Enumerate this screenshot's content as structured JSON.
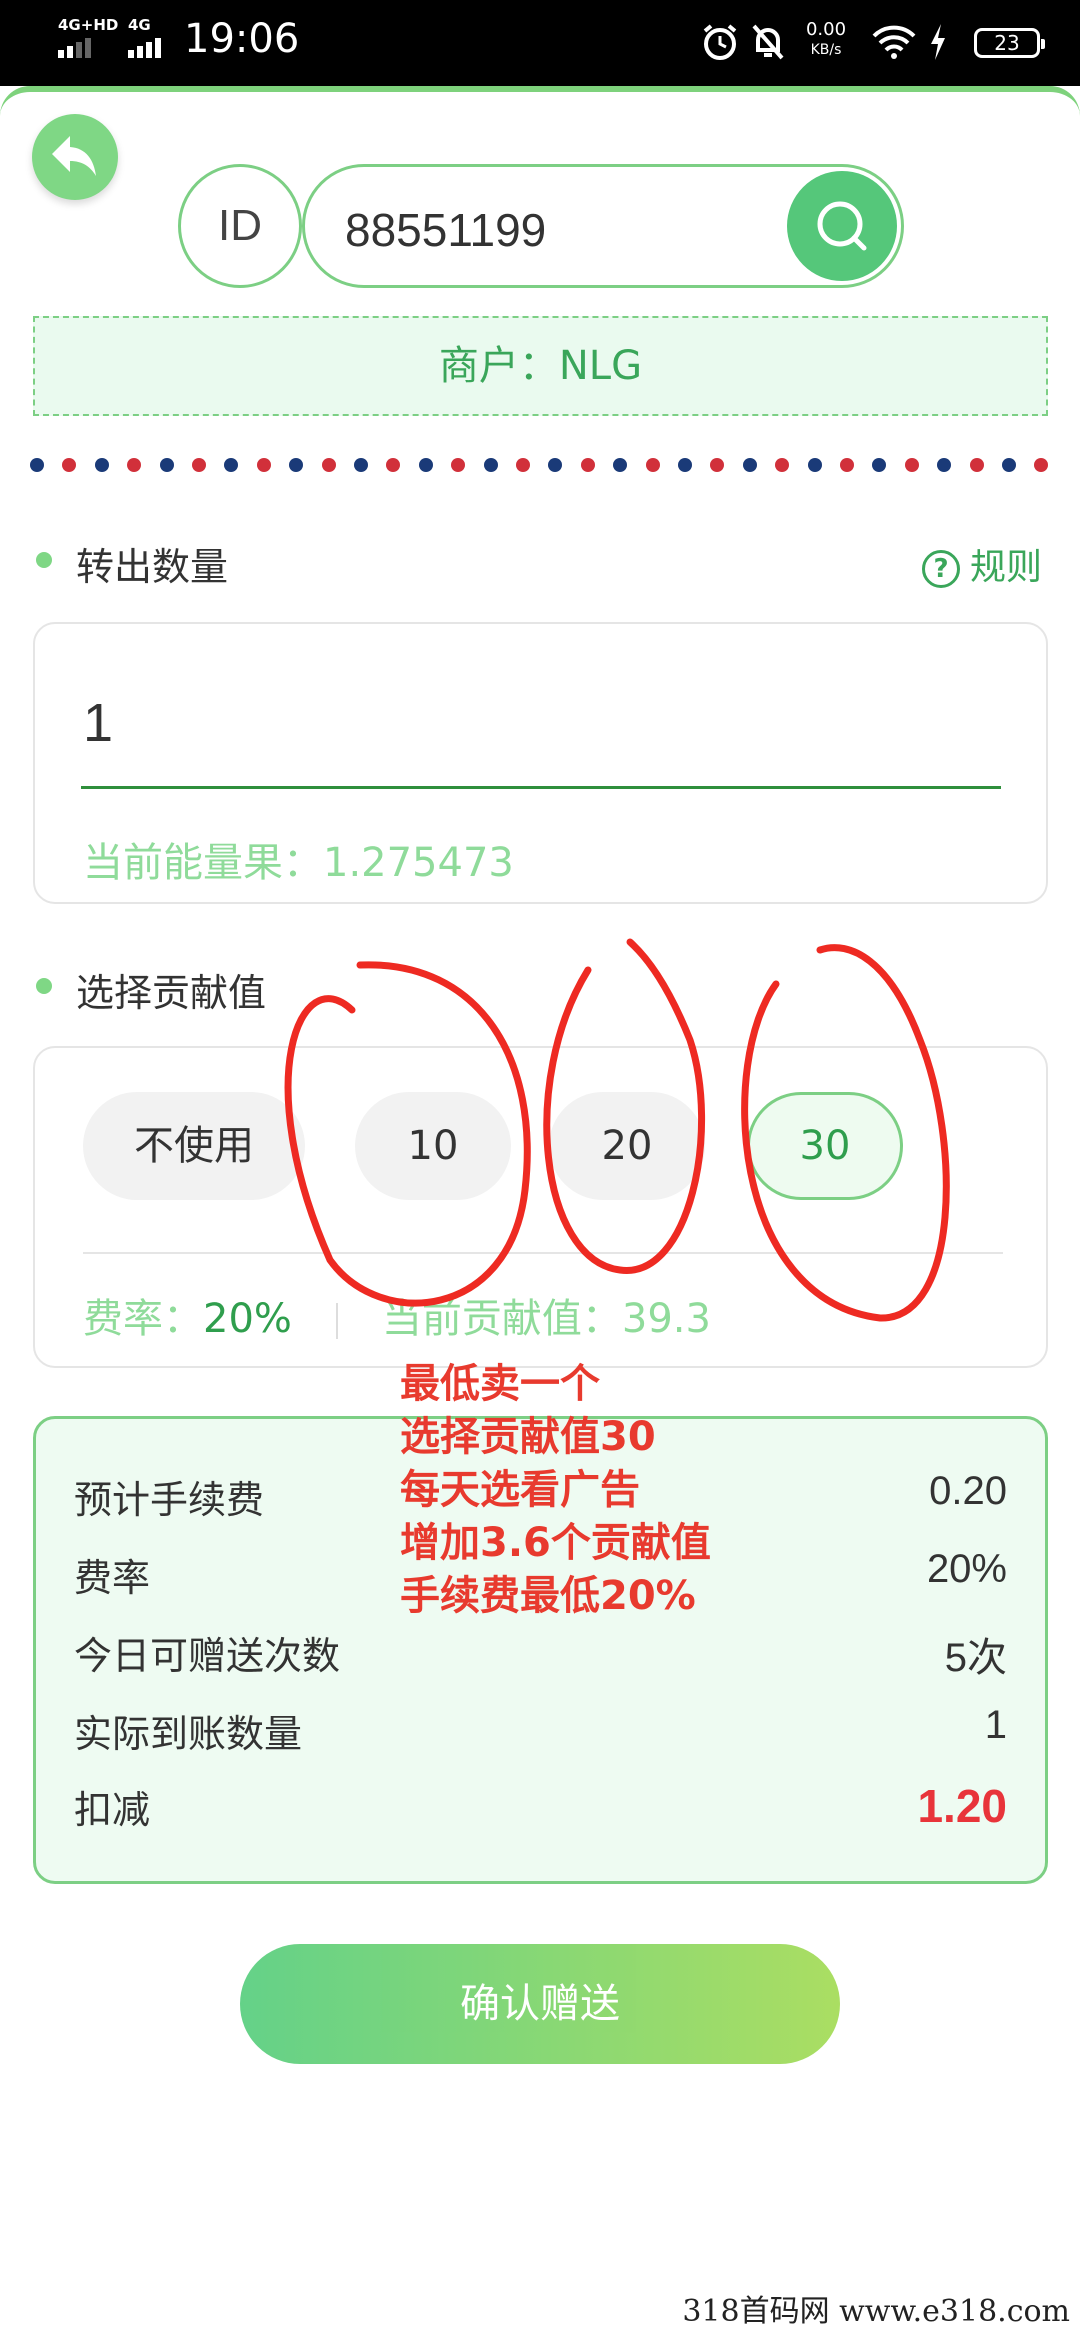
{
  "status_bar": {
    "network1": "4G+HD",
    "network2": "4G",
    "time": "19:06",
    "speed_value": "0.00",
    "speed_unit": "KB/s",
    "battery": "23"
  },
  "header": {
    "id_label": "ID",
    "id_value": "88551199",
    "merchant": "商户：NLG"
  },
  "transfer": {
    "title": "转出数量",
    "rule_label": "规则",
    "amount": "1",
    "energy_text": "当前能量果：1.275473"
  },
  "contribution": {
    "title": "选择贡献值",
    "options": [
      "不使用",
      "10",
      "20",
      "30"
    ],
    "selected": "30",
    "rate_label": "费率：",
    "rate_value": "20%",
    "current_label": "当前贡献值：",
    "current_value": "39.3"
  },
  "summary": {
    "rows": [
      {
        "label": "预计手续费",
        "value": "0.20"
      },
      {
        "label": "费率",
        "value": "20%"
      },
      {
        "label": "今日可赠送次数",
        "value": "5次"
      },
      {
        "label": "实际到账数量",
        "value": "1"
      },
      {
        "label": "扣减",
        "value": "1.20"
      }
    ]
  },
  "confirm_label": "确认赠送",
  "annotation": {
    "lines": [
      "最低卖一个",
      "选择贡献值30",
      "每天选看广告",
      "增加3.6个贡献值",
      "手续费最低20%"
    ]
  },
  "watermark": "318首码网  www.e318.com",
  "colors": {
    "primary_green": "#55c77a",
    "light_green": "#eefbf2",
    "accent_red": "#e8343a",
    "annotation_red": "#e83a2e"
  }
}
